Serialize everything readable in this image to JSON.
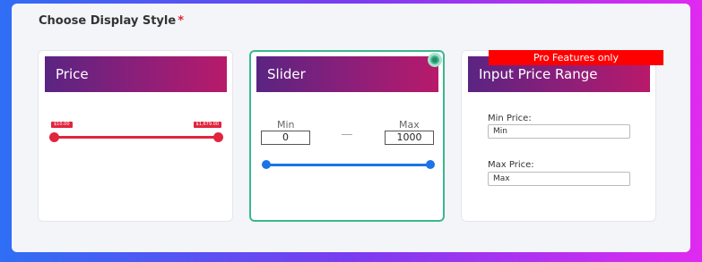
{
  "section": {
    "title": "Choose Display Style",
    "required_mark": "*"
  },
  "cards": [
    {
      "title": "Price",
      "min_tag": "$10.00",
      "max_tag": "$1,679.00",
      "selected": false
    },
    {
      "title": "Slider",
      "min_label": "Min",
      "max_label": "Max",
      "min_value": "0",
      "max_value": "1000",
      "separator": "—",
      "selected": true
    },
    {
      "title": "Input Price Range",
      "min_price_label": "Min Price:",
      "min_price_value": "Min",
      "max_price_label": "Max Price:",
      "max_price_value": "Max",
      "selected": false
    }
  ],
  "pro_badge": "Pro Features only",
  "colors": {
    "header_gradient_start": "#5a2482",
    "header_gradient_end": "#b81a6a",
    "price_slider": "#e0253d",
    "range_slider": "#1a73e8",
    "selected_border": "#3ab98d",
    "pro_badge": "#ff0000"
  }
}
